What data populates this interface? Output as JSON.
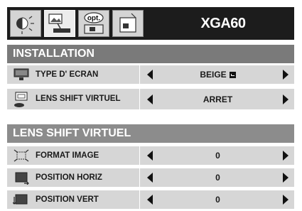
{
  "top": {
    "model": "XGA60",
    "tabs": [
      {
        "icon": "picture-adjust-icon"
      },
      {
        "icon": "installation-icon",
        "active": true
      },
      {
        "icon": "options-icon",
        "label": "opt."
      },
      {
        "icon": "info-icon"
      }
    ]
  },
  "installation": {
    "title": "INSTALLATION",
    "rows": [
      {
        "icon": "screen-type-icon",
        "label": "TYPE D' ECRAN",
        "value": "BEIGE"
      },
      {
        "icon": "lens-shift-icon",
        "label": "LENS SHIFT VIRTUEL",
        "value": "ARRET"
      }
    ]
  },
  "lens_shift": {
    "title": "LENS SHIFT VIRTUEL",
    "rows": [
      {
        "icon": "image-format-icon",
        "label": "FORMAT IMAGE",
        "value": "0"
      },
      {
        "icon": "horizontal-position-icon",
        "label": "POSITION HORIZ",
        "value": "0"
      },
      {
        "icon": "vertical-position-icon",
        "label": "POSITION VERT",
        "value": "0"
      }
    ]
  },
  "colors": {
    "panel": "#1c1c1c",
    "header": "#7a7a7a",
    "row": "#d6d6d6"
  }
}
